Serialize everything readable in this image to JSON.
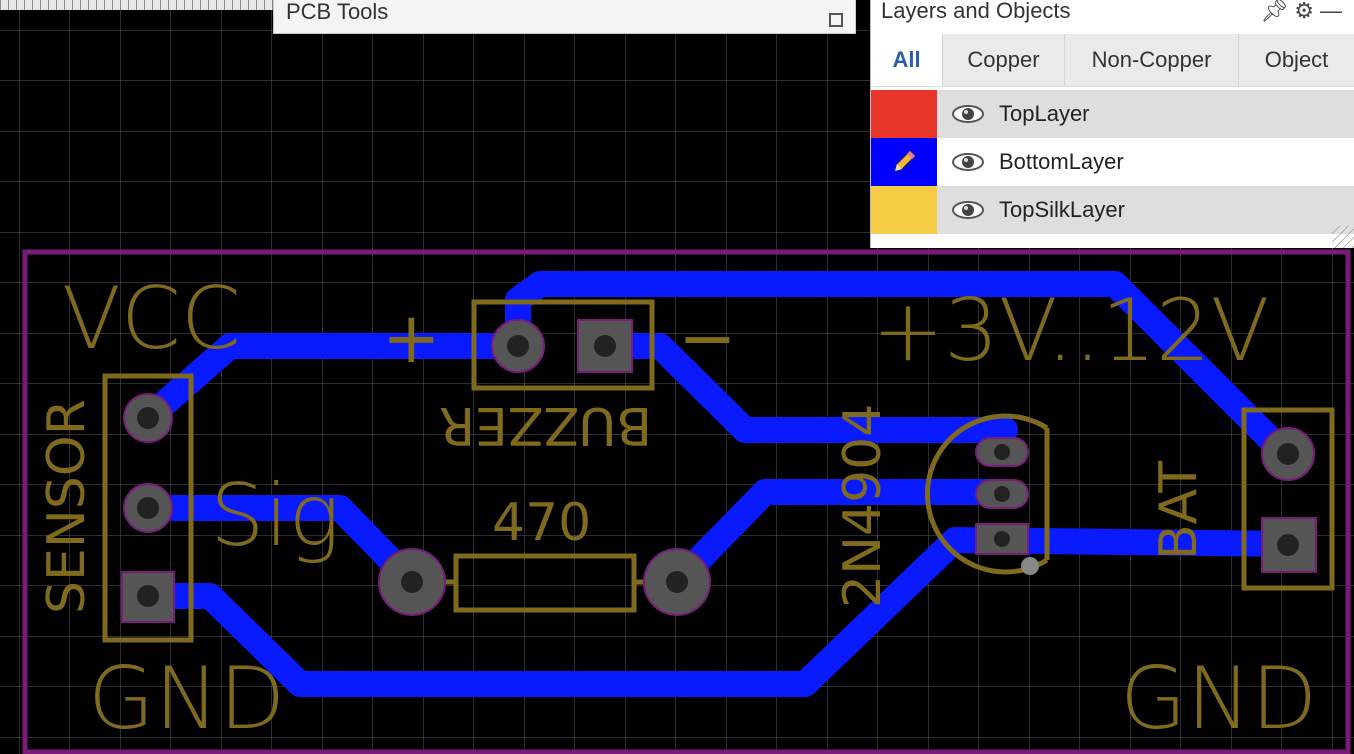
{
  "pcb_tools": {
    "title": "PCB Tools"
  },
  "layers_panel": {
    "title": "Layers and Objects",
    "icons": [
      "pin-icon",
      "gear-icon",
      "minimize-icon"
    ],
    "tabs": [
      {
        "label": "All",
        "active": true
      },
      {
        "label": "Copper",
        "active": false
      },
      {
        "label": "Non-Copper",
        "active": false
      },
      {
        "label": "Object",
        "active": false
      }
    ],
    "layers": [
      {
        "name": "TopLayer",
        "color": "#e8352a",
        "visible": true,
        "editing": false
      },
      {
        "name": "BottomLayer",
        "color": "#0000ff",
        "visible": true,
        "editing": true
      },
      {
        "name": "TopSilkLayer",
        "color": "#f5cc45",
        "visible": true,
        "editing": false
      }
    ]
  },
  "board": {
    "silk_labels": {
      "vcc": "VCC",
      "gnd_left": "GND",
      "gnd_right": "GND",
      "sensor": "SENSOR",
      "sig": "Sig",
      "buzzer": "BUZZER",
      "buzzer_plus": "+",
      "buzzer_minus": "−",
      "resistor_value": "470",
      "transistor": "2N4904",
      "voltage": "+3V..12V",
      "battery": "BAT"
    },
    "colors": {
      "board_outline": "#7a1a7a",
      "copper_bottom": "#0a1aff",
      "silkscreen": "#7f6a1e",
      "pad": "#555555",
      "grid": "#5a5a5a"
    }
  }
}
